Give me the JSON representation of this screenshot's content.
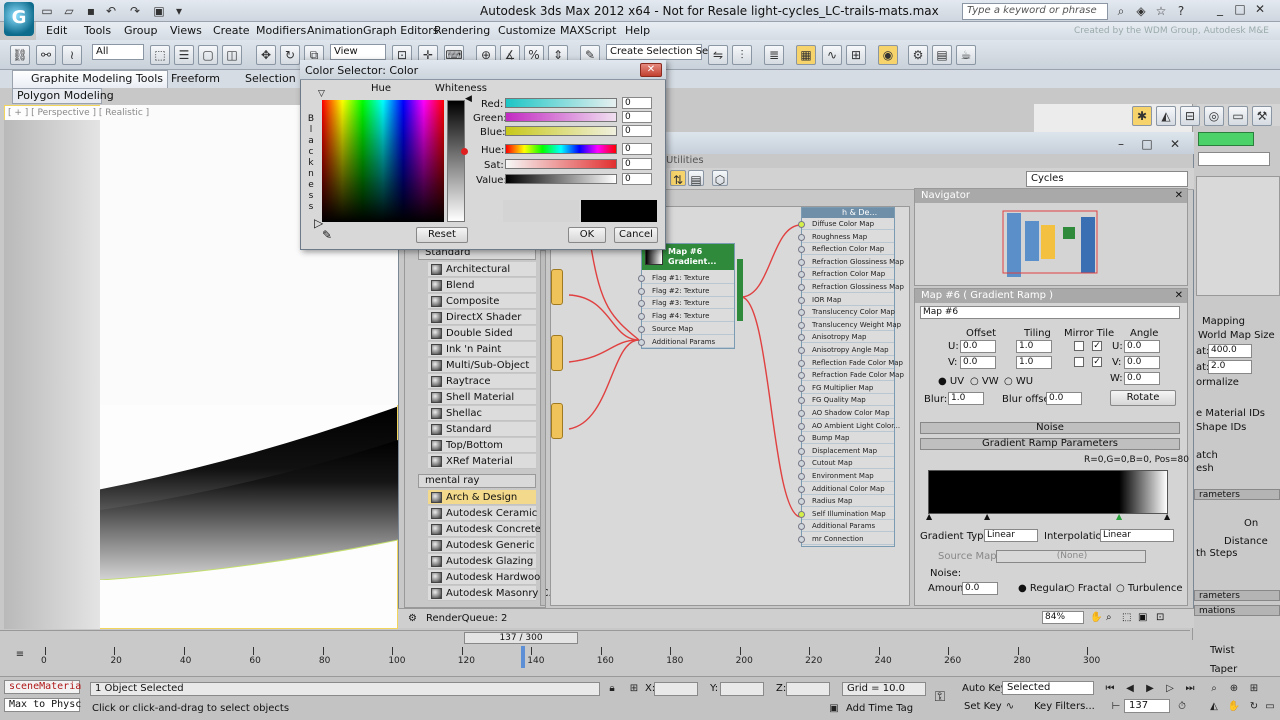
{
  "window": {
    "title": "Autodesk 3ds Max  2012 x64    -  Not for Resale    light-cycles_LC-trails-mats.max",
    "search_placeholder": "Type a keyword or phrase",
    "watermark": "Created by the WDM Group, Autodesk M&E",
    "controls": [
      "_",
      "□",
      "✕"
    ]
  },
  "menu": [
    "Edit",
    "Tools",
    "Group",
    "Views",
    "Create",
    "Modifiers",
    "Animation",
    "Graph Editors",
    "Rendering",
    "Customize",
    "MAXScript",
    "Help"
  ],
  "toolbar": {
    "selection_filter": "All",
    "ref_coord": "View",
    "named_selection": "Create Selection Se"
  },
  "ribbon": {
    "tabs": [
      "Graphite Modeling Tools",
      "Freeform",
      "Selection"
    ],
    "active_panel": "Polygon Modeling"
  },
  "viewport": {
    "label": "[ + ] [ Perspective ] [ Realistic ]"
  },
  "slate": {
    "menu_fragment": "Utilities",
    "view_name": "Cycles",
    "browser": {
      "standard_header": "Standard",
      "standard_items": [
        "Architectural",
        "Blend",
        "Composite",
        "DirectX Shader",
        "Double Sided",
        "Ink 'n Paint",
        "Multi/Sub-Object",
        "Raytrace",
        "Shell Material",
        "Shellac",
        "Standard",
        "Top/Bottom",
        "XRef Material"
      ],
      "mentalray_header": "mental ray",
      "mentalray_items": [
        "Arch & Design",
        "Autodesk Ceramic",
        "Autodesk Concrete",
        "Autodesk Generic",
        "Autodesk Glazing",
        "Autodesk Hardwood",
        "Autodesk Masonry C..."
      ]
    },
    "gradient_node": {
      "title": "Map #6\nGradient...",
      "slots": [
        "Flag #1: Texture",
        "Flag #2: Texture",
        "Flag #3: Texture",
        "Flag #4: Texture",
        "Source Map",
        "Additional Params"
      ]
    },
    "material_node": {
      "title": "h & De...",
      "slots": [
        "Diffuse Color Map",
        "Roughness Map",
        "Reflection Color Map",
        "Refraction Glossiness Map",
        "Refraction Color Map",
        "Refraction Glossiness Map",
        "IOR Map",
        "Translucency Color Map",
        "Translucency Weight Map",
        "Anisotropy Map",
        "Anisotropy Angle Map",
        "Reflection Fade Color Map",
        "Refraction Fade Color Map",
        "FG Multiplier Map",
        "FG Quality Map",
        "AO Shadow Color Map",
        "AO Ambient Light Color...",
        "Bump Map",
        "Displacement Map",
        "Cutout Map",
        "Environment Map",
        "Additional Color Map",
        "Radius Map",
        "Self Illumination Map",
        "Additional Params",
        "mr Connection"
      ]
    },
    "navigator_title": "Navigator",
    "params": {
      "title": "Map #6  ( Gradient Ramp )",
      "name": "Map #6",
      "col_offset": "Offset",
      "col_tiling": "Tiling",
      "col_mirror": "Mirror Tile",
      "col_angle": "Angle",
      "u_label": "U:",
      "v_label": "V:",
      "w_label": "W:",
      "u_offset": "0.0",
      "v_offset": "0.0",
      "u_tiling": "1.0",
      "v_tiling": "1.0",
      "u_angle": "0.0",
      "v_angle": "0.0",
      "w_angle": "0.0",
      "radio_uv": "UV",
      "radio_vw": "VW",
      "radio_wu": "WU",
      "blur_label": "Blur:",
      "blur_value": "1.0",
      "blur_offset_label": "Blur offset:",
      "blur_offset_value": "0.0",
      "rotate_label": "Rotate",
      "noise_rollout": "Noise",
      "gradient_rollout": "Gradient Ramp Parameters",
      "ramp_readout": "R=0,G=0,B=0, Pos=80",
      "gradient_type_label": "Gradient Type:",
      "gradient_type": "Linear",
      "interp_label": "Interpolation:",
      "interp": "Linear",
      "source_map_label": "Source Map:",
      "source_map": "(None)",
      "noise_label": "Noise:",
      "amount_label": "Amount:",
      "amount_value": "0.0",
      "noise_types": [
        "Regular",
        "Fractal",
        "Turbulence"
      ]
    },
    "status_text": "RenderQueue: 2",
    "zoom": "84%"
  },
  "color_dialog": {
    "title": "Color Selector: Color",
    "hue_label": "Hue",
    "whiteness_label": "Whiteness",
    "blackness_letters": [
      "B",
      "l",
      "a",
      "c",
      "k",
      "n",
      "e",
      "s",
      "s"
    ],
    "channels": [
      {
        "label": "Red:",
        "value": "0"
      },
      {
        "label": "Green:",
        "value": "0"
      },
      {
        "label": "Blue:",
        "value": "0"
      },
      {
        "label": "Hue:",
        "value": "0"
      },
      {
        "label": "Sat:",
        "value": "0"
      },
      {
        "label": "Value:",
        "value": "0"
      }
    ],
    "reset_label": "Reset",
    "ok_label": "OK",
    "cancel_label": "Cancel"
  },
  "command_panel": {
    "items": [
      "Mapping",
      "World Map Size",
      "400.0",
      "2.0",
      "ormalize",
      "e Material IDs",
      "Shape IDs",
      "atch",
      "esh",
      "rameters",
      "On",
      "Distance",
      "th Steps",
      "rameters",
      "mations",
      "Twist",
      "Taper"
    ],
    "labels": [
      "at:",
      "at:"
    ]
  },
  "timeline": {
    "frame_indicator": "137 / 300",
    "ticks": [
      "0",
      "20",
      "40",
      "60",
      "80",
      "100",
      "120",
      "140",
      "160",
      "180",
      "200",
      "220",
      "240",
      "260",
      "280",
      "300"
    ]
  },
  "status": {
    "listener_1": "sceneMateria",
    "listener_2": "Max to Physc",
    "selected": "1 Object Selected",
    "prompt": "Click or click-and-drag to select objects",
    "x_label": "X:",
    "y_label": "Y:",
    "z_label": "Z:",
    "grid": "Grid = 10.0",
    "add_time_tag": "Add Time Tag",
    "auto_key": "Auto Key",
    "set_key": "Set Key",
    "key_mode": "Selected",
    "key_filters": "Key Filters...",
    "current_frame": "137"
  }
}
